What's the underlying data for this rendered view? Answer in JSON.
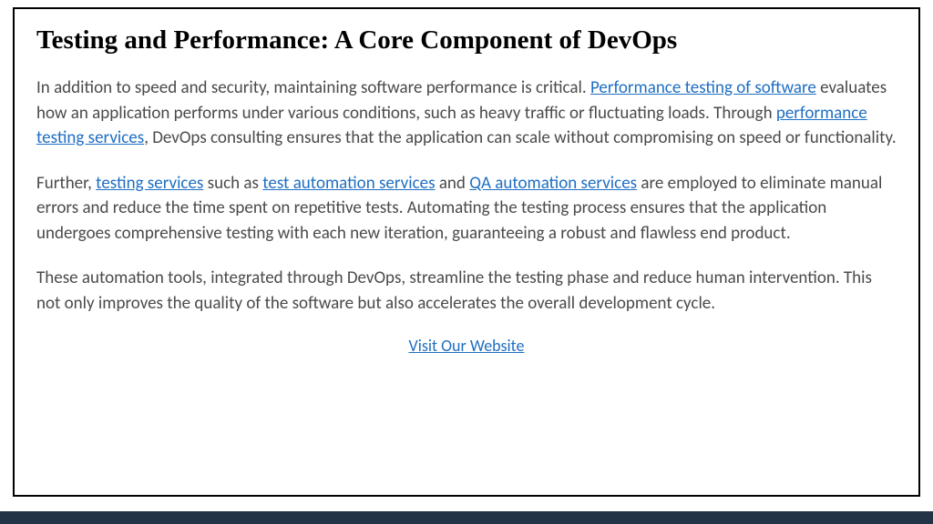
{
  "heading": "Testing and Performance: A Core Component of DevOps",
  "p1": {
    "t1": "In addition to speed and security, maintaining software performance is critical. ",
    "link1": "Performance testing of software",
    "t2": " evaluates how an application performs under various conditions, such as heavy traffic or fluctuating loads. Through ",
    "link2": "performance testing services",
    "t3": ", DevOps consulting ensures that the application can scale without compromising on speed or functionality."
  },
  "p2": {
    "t1": "Further, ",
    "link1": "testing services",
    "t2": " such as ",
    "link2": "test automation services",
    "t3": " and ",
    "link3": "QA automation services",
    "t4": " are employed to eliminate manual errors and reduce the time spent on repetitive tests. Automating the testing process ensures that the application undergoes comprehensive testing with each new iteration, guaranteeing a robust and flawless end product."
  },
  "p3": {
    "t1": "These automation tools, integrated through DevOps, streamline the testing phase and reduce human intervention. This not only improves the quality of the software but also accelerates the overall development cycle."
  },
  "cta": "Visit Our Website"
}
